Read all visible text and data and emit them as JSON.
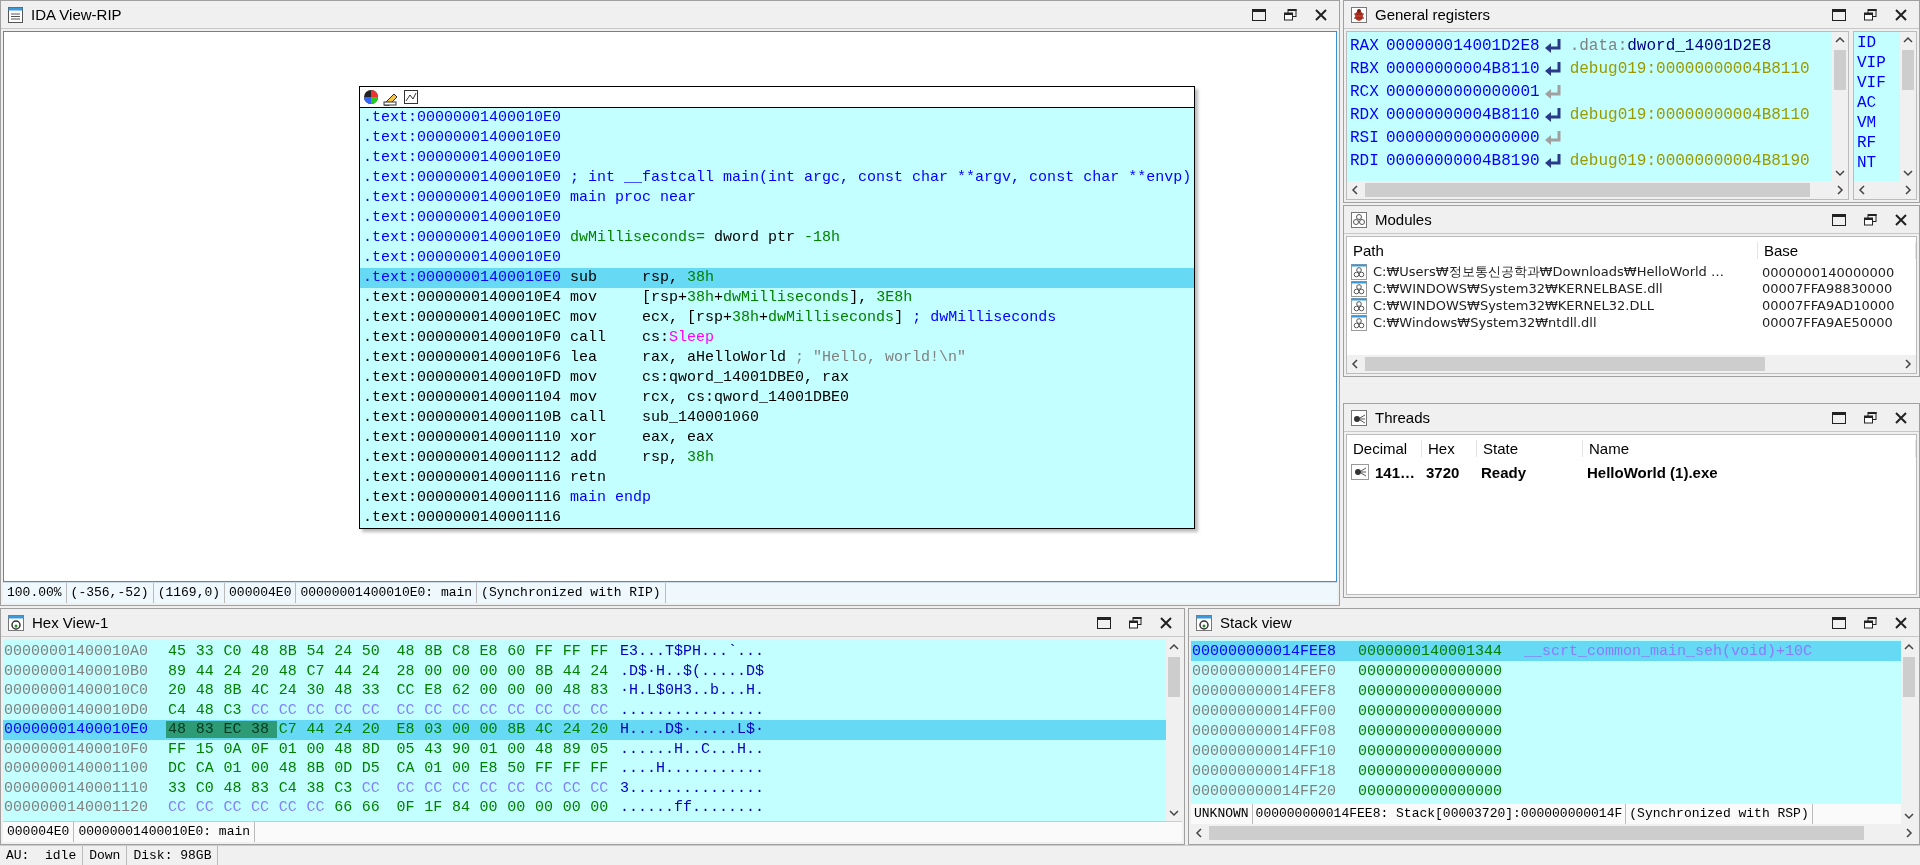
{
  "ida_view": {
    "title": "IDA View-RIP",
    "node_lines": [
      {
        "address": ".text:00000001400010E0",
        "kind": "header",
        "selected": false
      },
      {
        "address": ".text:00000001400010E0",
        "kind": "header",
        "selected": false
      },
      {
        "address": ".text:00000001400010E0",
        "kind": "header",
        "selected": false
      },
      {
        "address": ".text:00000001400010E0",
        "kind": "header",
        "selected": false,
        "parts": [
          {
            "kind": "keyword",
            "text": "; int __fastcall main(int argc, const char **argv, const char **envp)"
          }
        ]
      },
      {
        "address": ".text:00000001400010E0",
        "kind": "header",
        "selected": false,
        "parts": [
          {
            "kind": "keyword",
            "text": "main proc near"
          }
        ]
      },
      {
        "address": ".text:00000001400010E0",
        "kind": "header",
        "selected": false
      },
      {
        "address": ".text:00000001400010E0",
        "kind": "header",
        "selected": false,
        "parts": [
          {
            "kind": "name",
            "text": "dwMilliseconds="
          },
          {
            "kind": "plain",
            "text": " dword ptr "
          },
          {
            "kind": "number",
            "text": "-18h"
          }
        ]
      },
      {
        "address": ".text:00000001400010E0",
        "kind": "header",
        "selected": false
      },
      {
        "address": ".text:00000001400010E0",
        "kind": "header",
        "selected": true,
        "mnemonic": "sub",
        "parts": [
          {
            "kind": "plain",
            "text": "rsp, "
          },
          {
            "kind": "number",
            "text": "38h"
          }
        ]
      },
      {
        "address": ".text:00000001400010E4",
        "kind": "code",
        "selected": false,
        "mnemonic": "mov",
        "parts": [
          {
            "kind": "plain",
            "text": "[rsp+"
          },
          {
            "kind": "number",
            "text": "38h"
          },
          {
            "kind": "plain",
            "text": "+"
          },
          {
            "kind": "name",
            "text": "dwMilliseconds"
          },
          {
            "kind": "plain",
            "text": "], "
          },
          {
            "kind": "number",
            "text": "3E8h"
          }
        ]
      },
      {
        "address": ".text:00000001400010EC",
        "kind": "code",
        "selected": false,
        "mnemonic": "mov",
        "parts": [
          {
            "kind": "plain",
            "text": "ecx, [rsp+"
          },
          {
            "kind": "number",
            "text": "38h"
          },
          {
            "kind": "plain",
            "text": "+"
          },
          {
            "kind": "name",
            "text": "dwMilliseconds"
          },
          {
            "kind": "plain",
            "text": "] "
          },
          {
            "kind": "keyword",
            "text": "; dwMilliseconds"
          }
        ]
      },
      {
        "address": ".text:00000001400010F0",
        "kind": "code",
        "selected": false,
        "mnemonic": "call",
        "parts": [
          {
            "kind": "plain",
            "text": "cs:"
          },
          {
            "kind": "import",
            "text": "Sleep"
          }
        ]
      },
      {
        "address": ".text:00000001400010F6",
        "kind": "code",
        "selected": false,
        "mnemonic": "lea",
        "parts": [
          {
            "kind": "plain",
            "text": "rax, aHelloWorld "
          },
          {
            "kind": "comment",
            "text": "; \"Hello, world!\\n\""
          }
        ]
      },
      {
        "address": ".text:00000001400010FD",
        "kind": "code",
        "selected": false,
        "mnemonic": "mov",
        "parts": [
          {
            "kind": "plain",
            "text": "cs:qword_14001DBE0, rax"
          }
        ]
      },
      {
        "address": ".text:0000000140001104",
        "kind": "code",
        "selected": false,
        "mnemonic": "mov",
        "parts": [
          {
            "kind": "plain",
            "text": "rcx, cs:qword_14001DBE0"
          }
        ]
      },
      {
        "address": ".text:000000014000110B",
        "kind": "code",
        "selected": false,
        "mnemonic": "call",
        "parts": [
          {
            "kind": "plain",
            "text": "sub_140001060"
          }
        ]
      },
      {
        "address": ".text:0000000140001110",
        "kind": "code",
        "selected": false,
        "mnemonic": "xor",
        "parts": [
          {
            "kind": "plain",
            "text": "eax, eax"
          }
        ]
      },
      {
        "address": ".text:0000000140001112",
        "kind": "code",
        "selected": false,
        "mnemonic": "add",
        "parts": [
          {
            "kind": "plain",
            "text": "rsp, "
          },
          {
            "kind": "number",
            "text": "38h"
          }
        ]
      },
      {
        "address": ".text:0000000140001116",
        "kind": "code",
        "selected": false,
        "mnemonic": "retn"
      },
      {
        "address": ".text:0000000140001116",
        "kind": "code",
        "selected": false,
        "parts": [
          {
            "kind": "keyword",
            "text": "main endp"
          }
        ]
      },
      {
        "address": ".text:0000000140001116",
        "kind": "code",
        "selected": false
      }
    ],
    "status_bar": [
      "100.00%",
      "(-356,-52)",
      "(1169,0)",
      "000004E0",
      "00000001400010E0: main",
      "(Synchronized with RIP)"
    ]
  },
  "general_registers": {
    "title": "General registers",
    "registers": [
      {
        "name": "RAX",
        "value": "000000014001D2E8",
        "kind": "active",
        "target": [
          {
            "kind": "segment",
            "text": ".data:"
          },
          {
            "kind": "name",
            "text": "dword_14001D2E8"
          }
        ]
      },
      {
        "name": "RBX",
        "value": "00000000004B8110",
        "kind": "active",
        "target": [
          {
            "kind": "debug",
            "text": "debug019:00000000004B8110"
          }
        ]
      },
      {
        "name": "RCX",
        "value": "0000000000000001",
        "kind": "inactive"
      },
      {
        "name": "RDX",
        "value": "00000000004B8110",
        "kind": "active",
        "target": [
          {
            "kind": "debug",
            "text": "debug019:00000000004B8110"
          }
        ]
      },
      {
        "name": "RSI",
        "value": "0000000000000000",
        "kind": "inactive"
      },
      {
        "name": "RDI",
        "value": "00000000004B8190",
        "kind": "active",
        "target": [
          {
            "kind": "debug",
            "text": "debug019:00000000004B8190"
          }
        ]
      }
    ],
    "flags": [
      "ID",
      "VIP",
      "VIF",
      "AC",
      "VM",
      "RF",
      "NT"
    ]
  },
  "modules": {
    "title": "Modules",
    "columns": [
      "Path",
      "Base"
    ],
    "rows": [
      {
        "path": "C:₩Users₩정보통신공학과₩Downloads₩HelloWorld …",
        "base": "0000000140000000"
      },
      {
        "path": "C:₩WINDOWS₩System32₩KERNELBASE.dll",
        "base": "00007FFA98830000"
      },
      {
        "path": "C:₩WINDOWS₩System32₩KERNEL32.DLL",
        "base": "00007FFA9AD10000"
      },
      {
        "path": "C:₩Windows₩System32₩ntdll.dll",
        "base": "00007FFA9AE50000"
      }
    ]
  },
  "threads": {
    "title": "Threads",
    "columns": [
      "Decimal",
      "Hex",
      "State",
      "Name"
    ],
    "rows": [
      {
        "decimal": "141…",
        "hex": "3720",
        "state": "Ready",
        "name": "HelloWorld (1).exe"
      }
    ]
  },
  "hex_view": {
    "title": "Hex View-1",
    "rows": [
      {
        "address": "00000001400010A0",
        "selected": false,
        "groups": [
          {
            "kind": "code",
            "bytes": [
              "45",
              "33",
              "C0",
              "48",
              "8B",
              "54",
              "24",
              "50",
              "48",
              "8B",
              "C8",
              "E8",
              "60",
              "FF",
              "FF",
              "FF"
            ]
          }
        ],
        "ascii": "E3...T$PH...`..."
      },
      {
        "address": "00000001400010B0",
        "selected": false,
        "groups": [
          {
            "kind": "code",
            "bytes": [
              "89",
              "44",
              "24",
              "20",
              "48",
              "C7",
              "44",
              "24",
              "28",
              "00",
              "00",
              "00",
              "00",
              "8B",
              "44",
              "24"
            ]
          }
        ],
        "ascii": ".D$·H..$(.....D$"
      },
      {
        "address": "00000001400010C0",
        "selected": false,
        "groups": [
          {
            "kind": "code",
            "bytes": [
              "20",
              "48",
              "8B",
              "4C",
              "24",
              "30",
              "48",
              "33",
              "CC",
              "E8",
              "62",
              "00",
              "00",
              "00",
              "48",
              "83"
            ]
          }
        ],
        "ascii": "·H.L$0H3..b...H."
      },
      {
        "address": "00000001400010D0",
        "selected": false,
        "groups": [
          {
            "kind": "code",
            "bytes": [
              "C4",
              "48",
              "C3"
            ]
          },
          {
            "kind": "filler",
            "bytes": [
              "CC",
              "CC",
              "CC",
              "CC",
              "CC",
              "CC",
              "CC",
              "CC",
              "CC",
              "CC",
              "CC",
              "CC",
              "CC"
            ]
          }
        ],
        "ascii": "................"
      },
      {
        "address": "00000001400010E0",
        "selected": true,
        "groups": [
          {
            "kind": "cursor",
            "bytes": [
              "48",
              "83",
              "EC",
              "38"
            ]
          },
          {
            "kind": "code",
            "bytes": [
              "C7",
              "44",
              "24",
              "20",
              "E8",
              "03",
              "00",
              "00",
              "8B",
              "4C",
              "24",
              "20"
            ]
          }
        ],
        "ascii": "H....D$·.....L$·"
      },
      {
        "address": "00000001400010F0",
        "selected": false,
        "groups": [
          {
            "kind": "code",
            "bytes": [
              "FF",
              "15",
              "0A",
              "0F",
              "01",
              "00",
              "48",
              "8D",
              "05",
              "43",
              "90",
              "01",
              "00",
              "48",
              "89",
              "05"
            ]
          }
        ],
        "ascii": "......H..C...H.."
      },
      {
        "address": "0000000140001100",
        "selected": false,
        "groups": [
          {
            "kind": "code",
            "bytes": [
              "DC",
              "CA",
              "01",
              "00",
              "48",
              "8B",
              "0D",
              "D5",
              "CA",
              "01",
              "00",
              "E8",
              "50",
              "FF",
              "FF",
              "FF"
            ]
          }
        ],
        "ascii": "....H..........."
      },
      {
        "address": "0000000140001110",
        "selected": false,
        "groups": [
          {
            "kind": "code",
            "bytes": [
              "33",
              "C0",
              "48",
              "83",
              "C4",
              "38",
              "C3"
            ]
          },
          {
            "kind": "filler",
            "bytes": [
              "CC",
              "CC",
              "CC",
              "CC",
              "CC",
              "CC",
              "CC",
              "CC",
              "CC"
            ]
          }
        ],
        "ascii": "3..............."
      },
      {
        "address": "0000000140001120",
        "selected": false,
        "groups": [
          {
            "kind": "filler",
            "bytes": [
              "CC",
              "CC",
              "CC",
              "CC",
              "CC",
              "CC"
            ]
          },
          {
            "kind": "code",
            "bytes": [
              "66",
              "66",
              "0F",
              "1F",
              "84",
              "00",
              "00",
              "00",
              "00",
              "00"
            ]
          }
        ],
        "ascii": "......ff........"
      }
    ],
    "status_bar": [
      "000004E0",
      "00000001400010E0: main"
    ]
  },
  "stack_view": {
    "title": "Stack view",
    "rows": [
      {
        "address": "000000000014FEE8",
        "value": "0000000140001344",
        "comment": "__scrt_common_main_seh(void)+10C",
        "selected": true
      },
      {
        "address": "000000000014FEF0",
        "value": "0000000000000000",
        "selected": false
      },
      {
        "address": "000000000014FEF8",
        "value": "0000000000000000",
        "selected": false
      },
      {
        "address": "000000000014FF00",
        "value": "0000000000000000",
        "selected": false
      },
      {
        "address": "000000000014FF08",
        "value": "0000000000000000",
        "selected": false
      },
      {
        "address": "000000000014FF10",
        "value": "0000000000000000",
        "selected": false
      },
      {
        "address": "000000000014FF18",
        "value": "0000000000000000",
        "selected": false
      },
      {
        "address": "000000000014FF20",
        "value": "0000000000000000",
        "selected": false
      }
    ],
    "status_bar": [
      "UNKNOWN",
      "000000000014FEE8: Stack[00003720]:000000000014F",
      "(Synchronized with RSP)"
    ]
  },
  "status_bar": [
    "AU:  idle",
    "Down",
    "Disk: 98GB"
  ]
}
